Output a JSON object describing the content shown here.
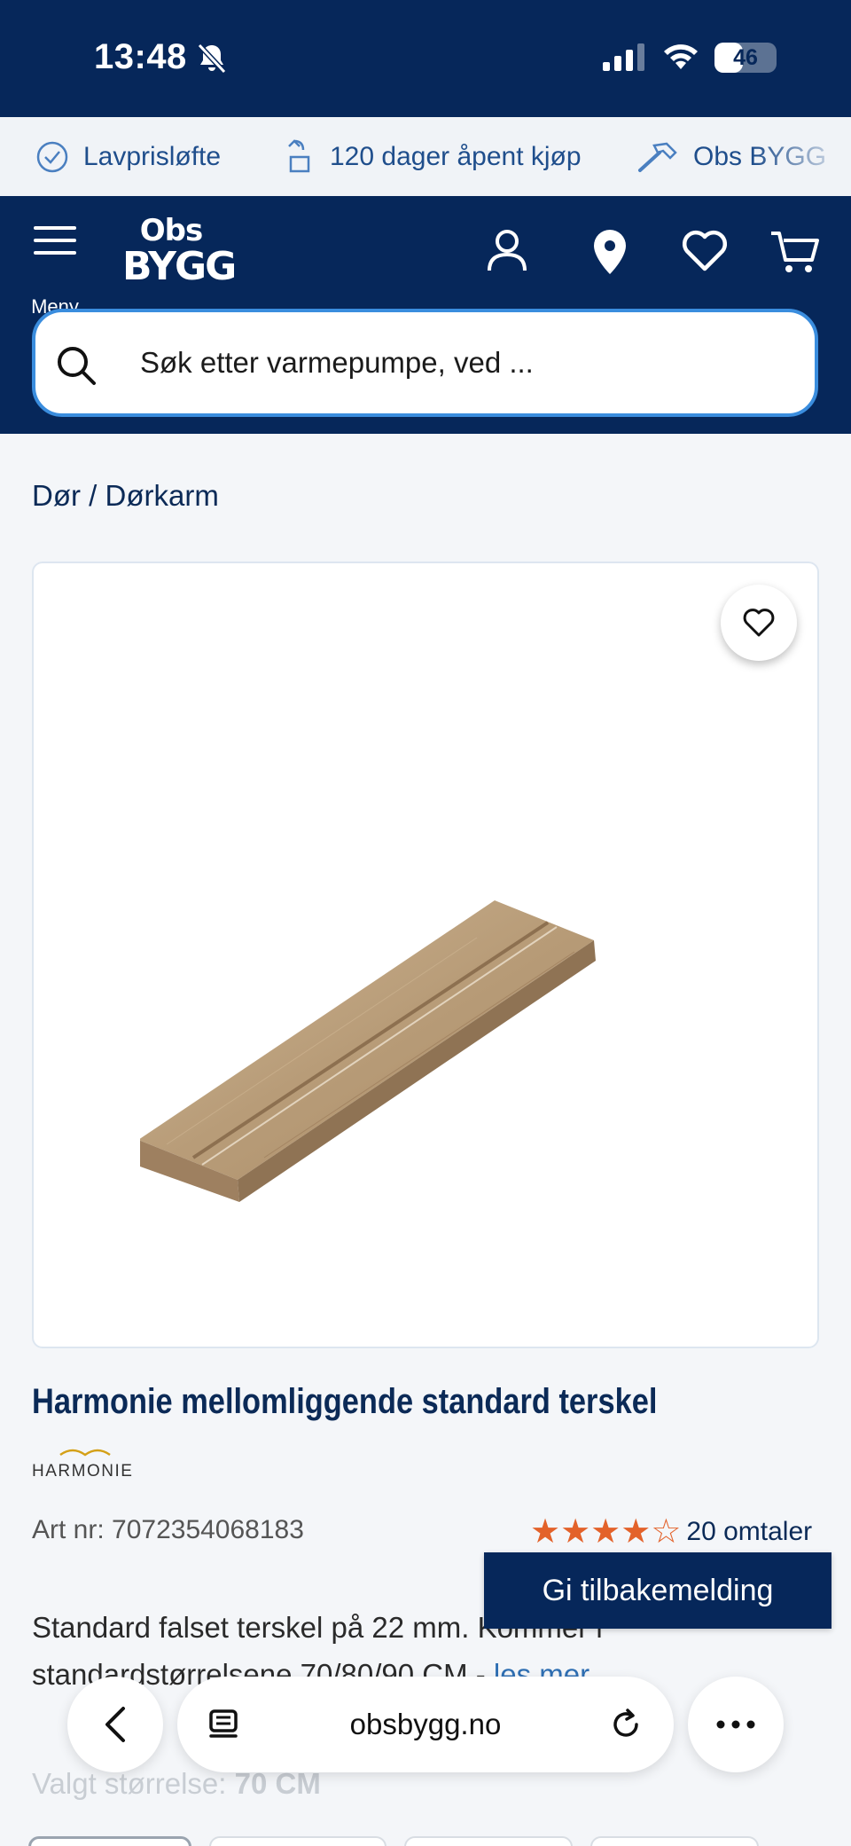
{
  "status_bar": {
    "time": "13:48",
    "battery": "46",
    "battery_level": 0.46
  },
  "usp": [
    {
      "icon": "check-circle-icon",
      "label": "Lavprisløfte"
    },
    {
      "icon": "return-box-icon",
      "label": "120 dager åpent kjøp"
    },
    {
      "icon": "hammer-icon",
      "label": "Obs BYGG"
    }
  ],
  "header": {
    "menu_label": "Meny",
    "logo_top": "Obs",
    "logo_bottom": "BYGG",
    "search_placeholder": "Søk etter varmepumpe, ved ..."
  },
  "breadcrumb": {
    "parent": "Dør",
    "separator": "/",
    "current": "Dørkarm"
  },
  "product": {
    "title": "Harmonie mellomliggende standard terskel",
    "brand": "HARMONIE",
    "art_nr": "Art nr: 7072354068183",
    "rating": 4,
    "rating_max": 5,
    "reviews": "20 omtaler",
    "description": "Standard falset terskel på 22 mm. Kommer i standardstørrelsene 70/80/90 CM - ",
    "read_more": "les mer",
    "size_label": "Valgt størrelse:",
    "size_value": "70 CM"
  },
  "feedback_button": "Gi tilbakemelding",
  "browser": {
    "url": "obsbygg.no"
  },
  "colors": {
    "navy": "#06275a",
    "accent_blue": "#3a8dde",
    "star": "#e3622a"
  }
}
